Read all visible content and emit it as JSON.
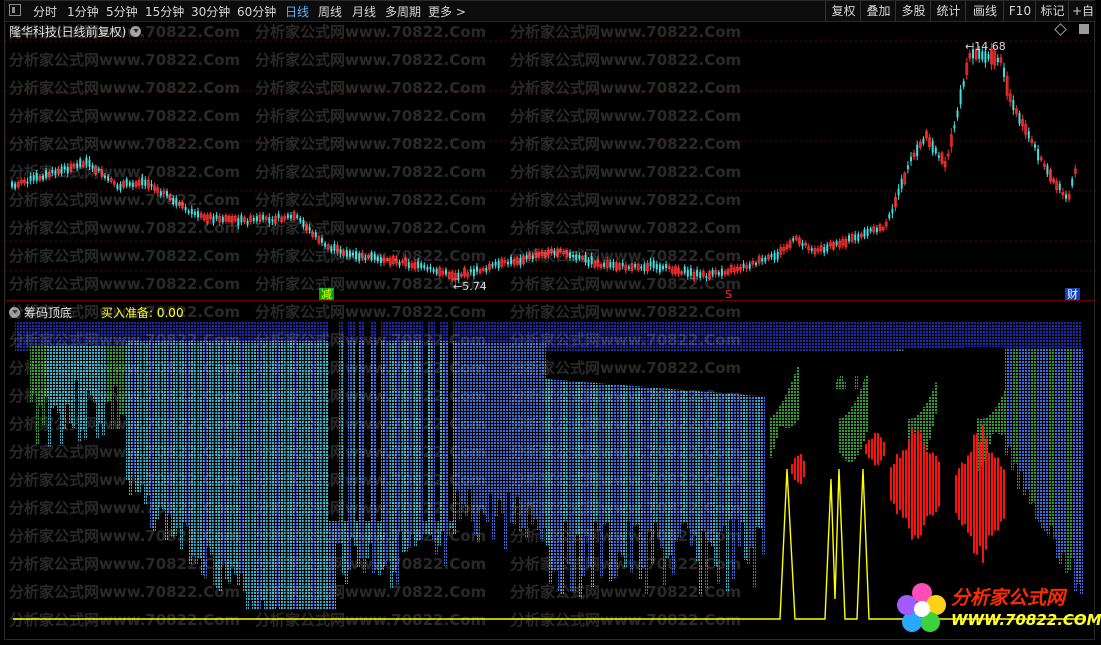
{
  "toolbar": {
    "periods": [
      {
        "label": "分时",
        "active": false
      },
      {
        "label": "1分钟",
        "active": false
      },
      {
        "label": "5分钟",
        "active": false
      },
      {
        "label": "15分钟",
        "active": false
      },
      {
        "label": "30分钟",
        "active": false
      },
      {
        "label": "60分钟",
        "active": false
      },
      {
        "label": "日线",
        "active": true
      },
      {
        "label": "周线",
        "active": false
      },
      {
        "label": "月线",
        "active": false
      },
      {
        "label": "多周期",
        "active": false
      },
      {
        "label": "更多 >",
        "active": false
      }
    ],
    "right_buttons": [
      "复权",
      "叠加",
      "多股",
      "统计",
      "画线",
      "F10",
      "标记",
      "+自"
    ]
  },
  "main_chart": {
    "title": "隆华科技(日线前复权)",
    "high_label": "14.68",
    "low_label": "5.74",
    "up_color": "#ff3030",
    "down_color": "#40e0e0",
    "badges": [
      {
        "text": "减",
        "fg": "#ffff00",
        "bg": "#00a000"
      },
      {
        "text": "S",
        "fg": "#ff3030",
        "bg": "transparent"
      },
      {
        "text": "财",
        "fg": "#ffffff",
        "bg": "#1040c0"
      }
    ]
  },
  "indicator": {
    "name": "筹码顶底",
    "value_text": "买入准备: 0.00",
    "colors": {
      "deep": "#1a2ab0",
      "mid": "#3a6cd8",
      "cyan": "#30b8d0",
      "green": "#30a030",
      "red": "#ff1010",
      "yellow": "#ffff00"
    }
  },
  "watermark": {
    "text": "分析家公式网www.70822.Com"
  },
  "logo": {
    "name": "分析家公式网",
    "url": "WWW.70822.COM"
  }
}
